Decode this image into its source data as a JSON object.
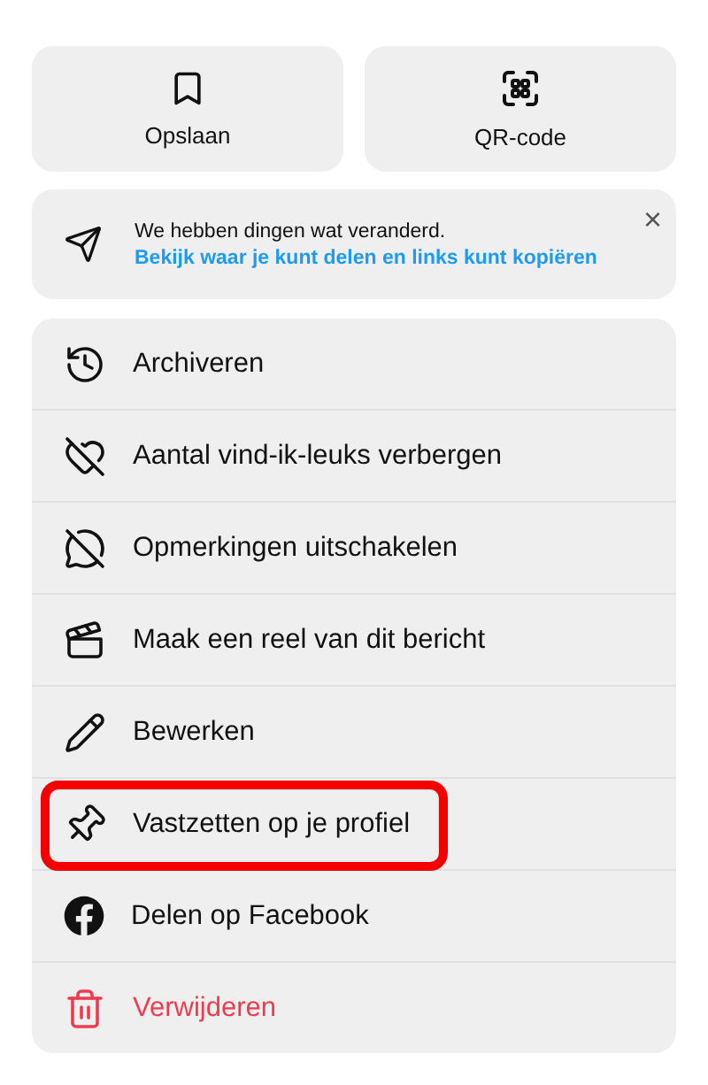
{
  "actions": [
    {
      "label": "Opslaan"
    },
    {
      "label": "QR-code"
    }
  ],
  "notice": {
    "text": "We hebben dingen wat veranderd.",
    "link": "Bekijk waar je kunt delen en links kunt kopiëren",
    "close": "×"
  },
  "menu": [
    {
      "label": "Archiveren",
      "kind": "normal",
      "highlighted": false
    },
    {
      "label": "Aantal vind-ik-leuks verbergen",
      "kind": "normal",
      "highlighted": false
    },
    {
      "label": "Opmerkingen uitschakelen",
      "kind": "normal",
      "highlighted": false
    },
    {
      "label": "Maak een reel van dit bericht",
      "kind": "normal",
      "highlighted": false
    },
    {
      "label": "Bewerken",
      "kind": "normal",
      "highlighted": false
    },
    {
      "label": "Vastzetten op je profiel",
      "kind": "normal",
      "highlighted": true
    },
    {
      "label": "Delen op Facebook",
      "kind": "normal",
      "highlighted": false
    },
    {
      "label": "Verwijderen",
      "kind": "destructive",
      "highlighted": false
    }
  ]
}
